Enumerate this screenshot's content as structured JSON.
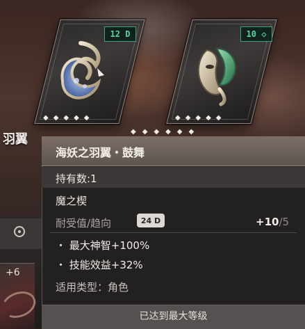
{
  "cards": [
    {
      "name": "wing-card",
      "cost": "12",
      "cost_icon": "D"
    },
    {
      "name": "mask-card",
      "cost": "10",
      "cost_icon": "◇"
    }
  ],
  "gem_row_left": "◆◆◆◆◆",
  "gem_row_right": "◆◆◆◆◆",
  "gem_row_below": "◆◆◆◆◆◆",
  "partial_name": "羽翼",
  "tooltip": {
    "title": "海妖之羽翼・鼓舞",
    "count": "持有数:1",
    "category": "魔之楔",
    "stat_label": "耐受值/趋向",
    "stat_badge": "24 D",
    "stat_current": "+10",
    "stat_max": "/5",
    "effects": [
      "・ 最大神智+100%",
      "・ 技能效益+32%"
    ],
    "applies": "适用类型：角色",
    "footer": "已达到最大等级"
  },
  "side_card_label": "+6",
  "colors": {
    "accent_green": "#58d4a2",
    "tooltip_bg": "#222020",
    "header_bg": "#6e645e"
  }
}
